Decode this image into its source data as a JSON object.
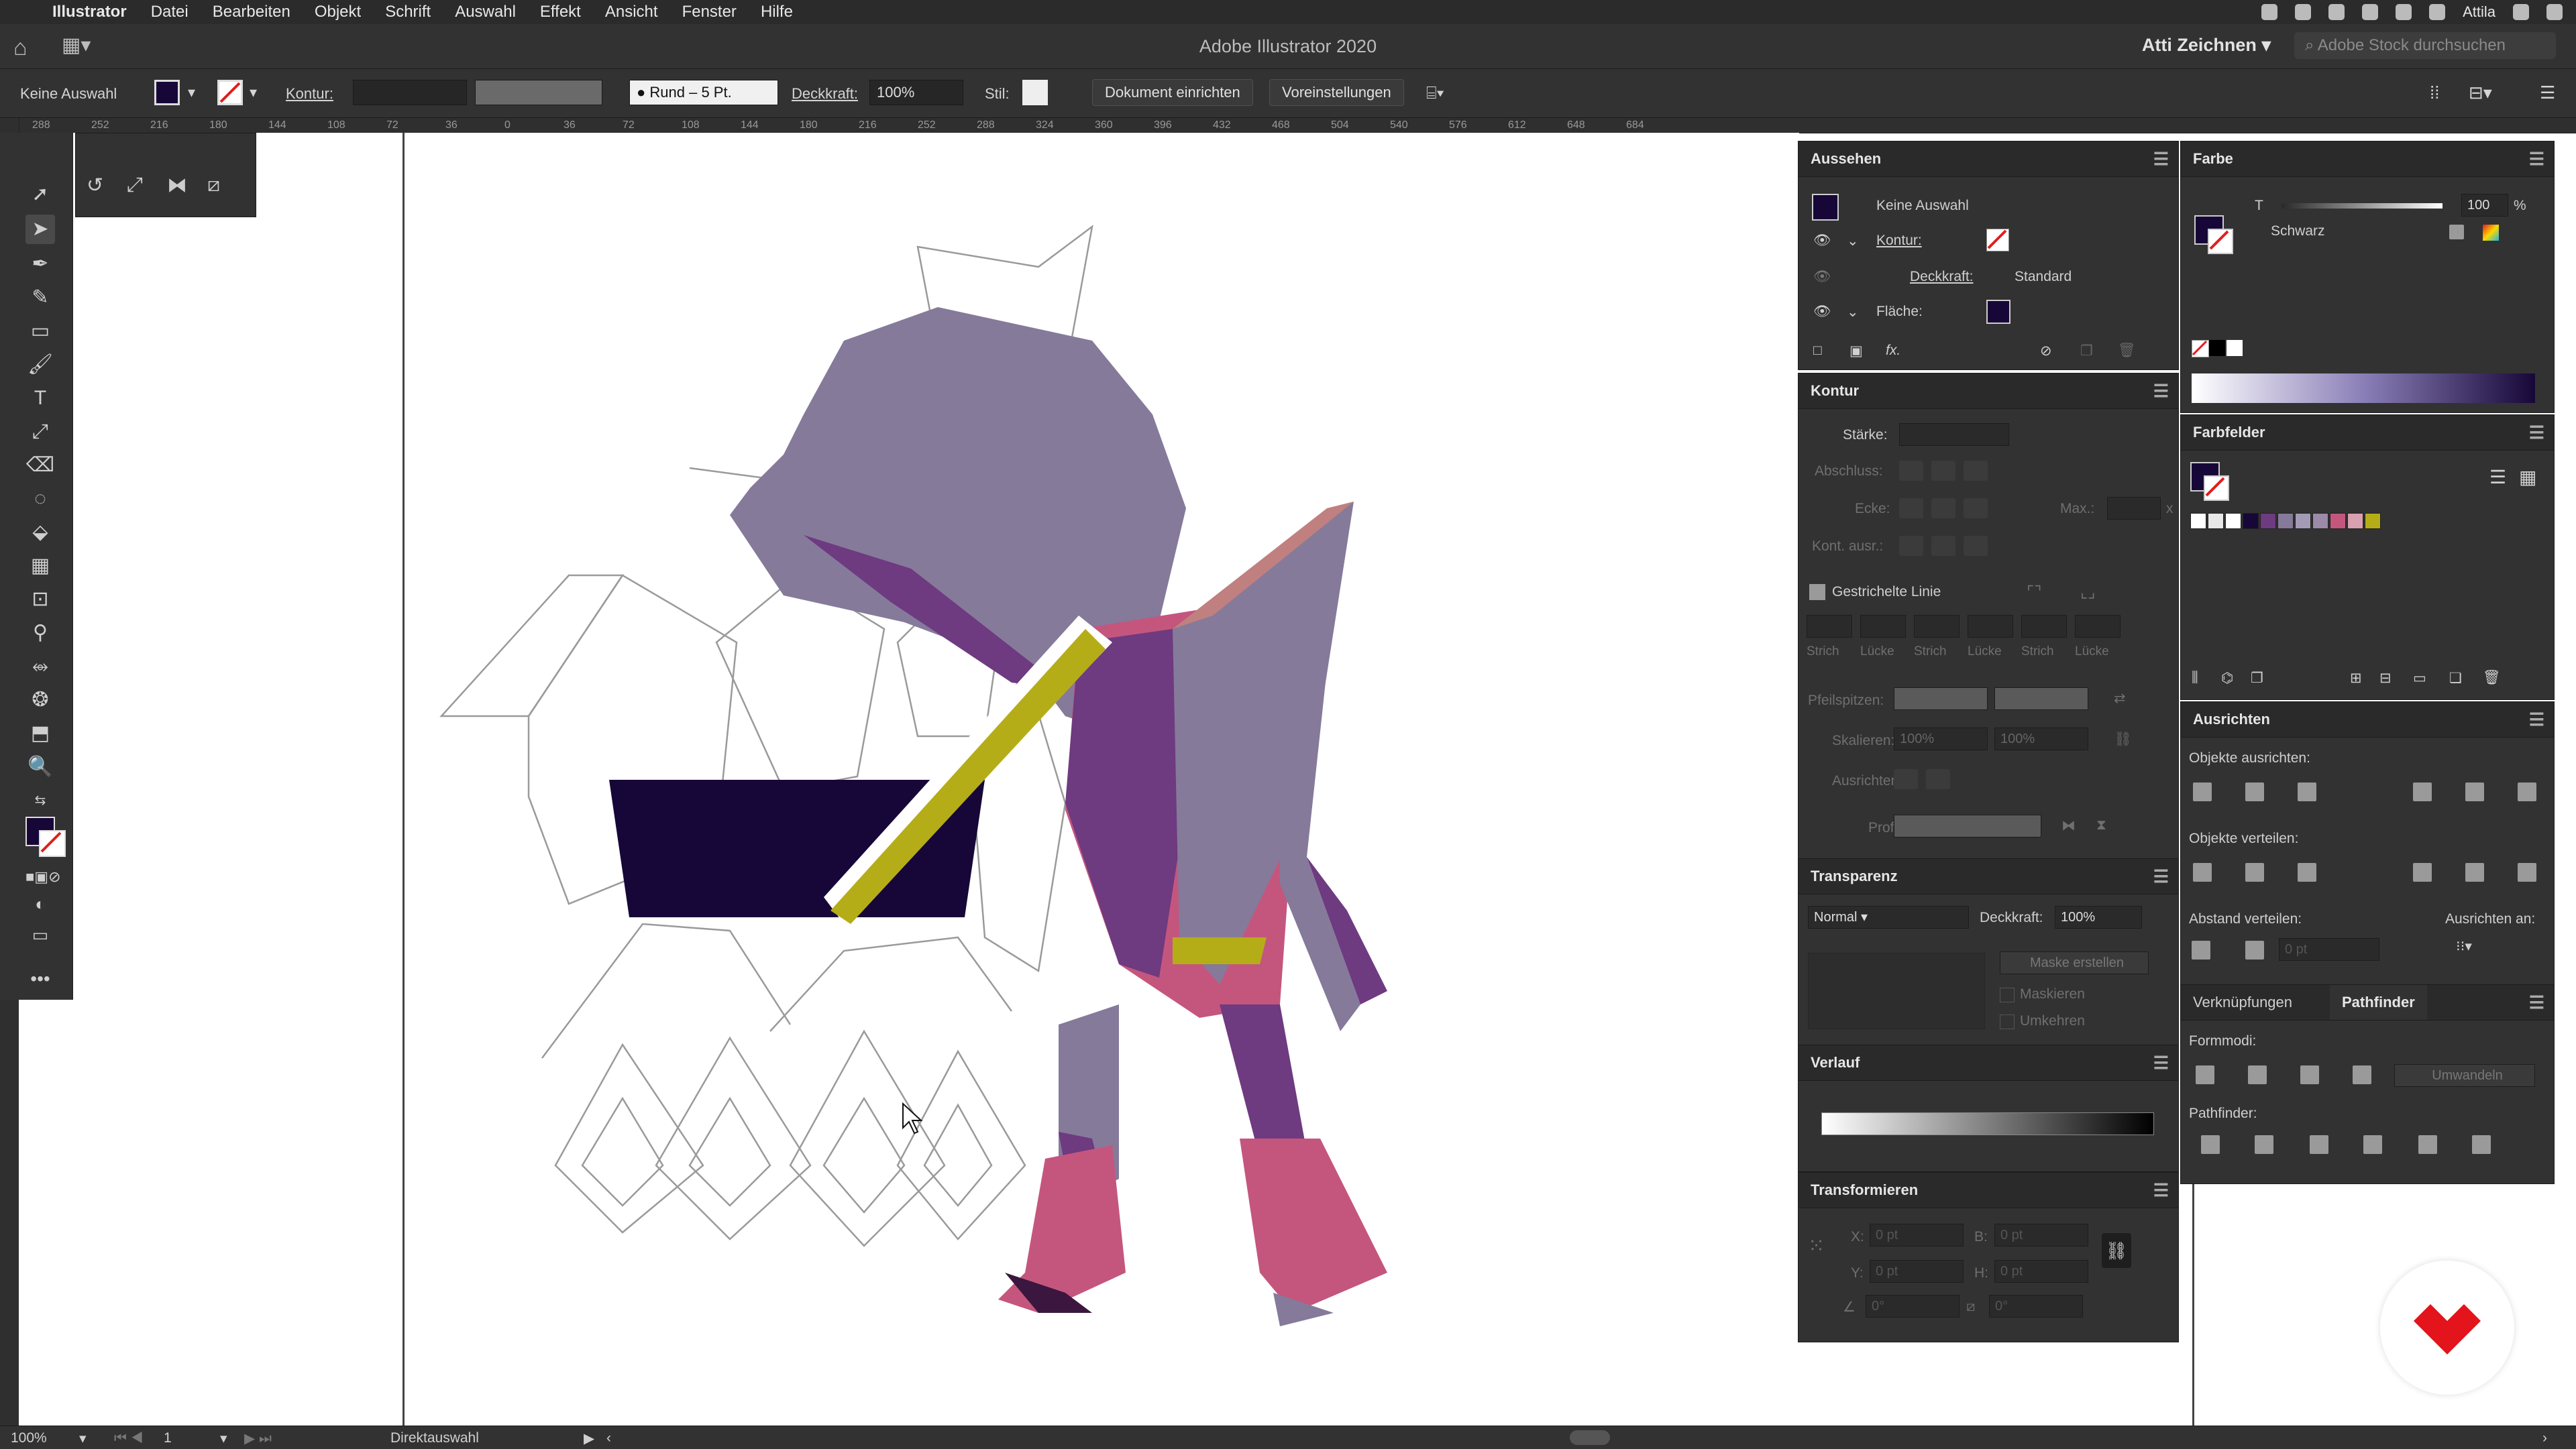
{
  "menubar": {
    "app_name": "Illustrator",
    "items": [
      "Datei",
      "Bearbeiten",
      "Objekt",
      "Schrift",
      "Auswahl",
      "Effekt",
      "Ansicht",
      "Fenster",
      "Hilfe"
    ],
    "user": "Attila"
  },
  "window": {
    "title": "Adobe Illustrator 2020",
    "workspace": "Atti Zeichnen",
    "stock_search_placeholder": "Adobe Stock durchsuchen"
  },
  "control_bar": {
    "selection": "Keine Auswahl",
    "stroke_label": "Kontur:",
    "brush_label": "Rund – 5 Pt.",
    "opacity_label": "Deckkraft:",
    "opacity_value": "100%",
    "style_label": "Stil:",
    "doc_setup_button": "Dokument einrichten",
    "preferences_button": "Voreinstellungen"
  },
  "ruler_ticks": [
    "288",
    "252",
    "216",
    "180",
    "144",
    "108",
    "72",
    "36",
    "0",
    "36",
    "72",
    "108",
    "144",
    "180",
    "216",
    "252",
    "288",
    "324",
    "360",
    "396",
    "432",
    "468",
    "504",
    "540",
    "576",
    "612",
    "648",
    "684"
  ],
  "panels": {
    "aussehen": {
      "title": "Aussehen",
      "object": "Keine Auswahl",
      "kontur": "Kontur:",
      "deckkraft": "Deckkraft:",
      "deckkraft_value": "Standard",
      "flaeche": "Fläche:"
    },
    "kontur": {
      "title": "Kontur",
      "staerke": "Stärke:",
      "abschluss": "Abschluss:",
      "ecke": "Ecke:",
      "max": "Max.:",
      "max_unit": "x",
      "kont_ausr": "Kont. ausr.:",
      "gestrichelte": "Gestrichelte Linie",
      "dash_labels": [
        "Strich",
        "Lücke",
        "Strich",
        "Lücke",
        "Strich",
        "Lücke"
      ],
      "pfeilspitzen": "Pfeilspitzen:",
      "skalieren": "Skalieren:",
      "skalieren_vals": [
        "100%",
        "100%"
      ],
      "ausrichten": "Ausrichten:",
      "profil": "Profil:"
    },
    "transparenz": {
      "title": "Transparenz",
      "mode": "Normal",
      "deckkraft": "Deckkraft:",
      "deckkraft_value": "100%",
      "maske_button": "Maske erstellen",
      "maskieren": "Maskieren",
      "umkehren": "Umkehren"
    },
    "verlauf": {
      "title": "Verlauf"
    },
    "transformieren": {
      "title": "Transformieren",
      "x": "X:",
      "x_val": "0 pt",
      "y": "Y:",
      "y_val": "0 pt",
      "b": "B:",
      "b_val": "0 pt",
      "h": "H:",
      "h_val": "0 pt",
      "angle_val": "0°",
      "shear_val": "0°"
    },
    "farbe": {
      "title": "Farbe",
      "t_label": "T",
      "value": "100",
      "unit": "%",
      "name": "Schwarz"
    },
    "farbfelder": {
      "title": "Farbfelder"
    },
    "ausrichten": {
      "title": "Ausrichten",
      "objekte_ausrichten": "Objekte ausrichten:",
      "objekte_verteilen": "Objekte verteilen:",
      "abstand_verteilen": "Abstand verteilen:",
      "ausrichten_an": "Ausrichten an:",
      "abstand_value": "0 pt"
    },
    "pathfinder": {
      "tab_links": "Verknüpfungen",
      "tab_pathfinder": "Pathfinder",
      "formmodi": "Formmodi:",
      "umwandeln": "Umwandeln",
      "pathfinder_label": "Pathfinder:"
    }
  },
  "status_bar": {
    "zoom": "100%",
    "artboard": "1",
    "tool": "Direktauswahl"
  },
  "colors": {
    "fill": "#170738",
    "character_main": "#857a9a",
    "character_pink": "#c4567e",
    "character_purple": "#6e3a80",
    "stick": "#b5ad18",
    "logo_red": "#e3141b"
  }
}
